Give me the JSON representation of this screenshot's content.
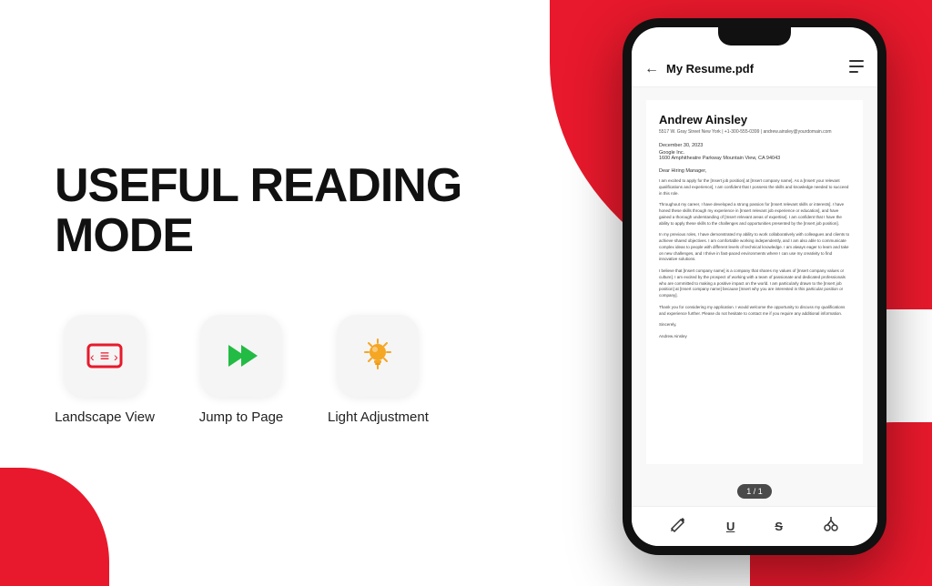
{
  "background": {
    "colors": {
      "primary_red": "#e8192c",
      "white": "#ffffff",
      "dark": "#111111"
    }
  },
  "left": {
    "main_title": "USEFUL READING MODE",
    "features": [
      {
        "id": "landscape",
        "label": "Landscape View",
        "icon_name": "landscape-icon",
        "icon_color": "#e8192c",
        "icon_symbol": "⊙"
      },
      {
        "id": "jump",
        "label": "Jump to Page",
        "icon_name": "jump-icon",
        "icon_color": "#22bb44",
        "icon_symbol": "⏩"
      },
      {
        "id": "light",
        "label": "Light Adjustment",
        "icon_name": "light-icon",
        "icon_color": "#f5a623",
        "icon_symbol": "💡"
      }
    ]
  },
  "phone": {
    "app_header": {
      "back_label": "←",
      "file_name": "My Resume.pdf",
      "menu_icon": "⊞"
    },
    "resume": {
      "name": "Andrew Ainsley",
      "contact": "5517 W. Gray Street  New York | +1-300-555-0399 | andrew.ainsley@yourdomain.com",
      "date": "December 30, 2023",
      "recipient_company": "Google Inc.",
      "recipient_address": "1600 Amphitheatre Parkway Mountain View, CA 94043",
      "salutation": "Dear Hiring Manager,",
      "paragraph1": "I am excited to apply for the [Insert job position] at [Insert company name]. As a [Insert your relevant qualifications and experience], I am confident that I possess the skills and knowledge needed to succeed in this role.",
      "paragraph2": "Throughout my career, I have developed a strong passion for [Insert relevant skills or interests]. I have honed these skills through my experience in [Insert relevant job experience or education], and have gained a thorough understanding of [Insert relevant areas of expertise]. I am confident that I have the ability to apply these skills to the challenges and opportunities presented by the [Insert job position].",
      "paragraph3": "In my previous roles, I have demonstrated my ability to work collaboratively with colleagues and clients to achieve shared objectives. I am comfortable working independently, and I am also able to communicate complex ideas to people with different levels of technical knowledge. I am always eager to learn and take on new challenges, and I thrive in fast-paced environments where I can use my creativity to find innovative solutions.",
      "paragraph4": "I believe that [Insert company name] is a company that shares my values of [Insert company values or culture]. I am excited by the prospect of working with a team of passionate and dedicated professionals who are committed to making a positive impact on the world. I am particularly drawn to the [Insert job position] at [Insert company name] because [Insert why you are interested in this particular position or company].",
      "paragraph5": "Thank you for considering my application. I would welcome the opportunity to discuss my qualifications and experience further. Please do not hesitate to contact me if you require any additional information.",
      "closing": "Sincerely,",
      "signature": "Andrew Ainsley"
    },
    "page_counter": "1 / 1",
    "toolbar_icons": [
      "✏️",
      "U",
      "S",
      "✂️"
    ]
  }
}
